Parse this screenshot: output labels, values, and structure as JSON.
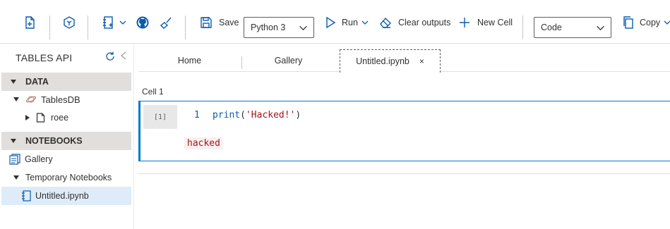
{
  "toolbar": {
    "save_label": "Save",
    "kernel": "Python 3",
    "run_label": "Run",
    "clear_label": "Clear outputs",
    "new_cell_label": "New Cell",
    "cell_type": "Code",
    "copy_label": "Copy"
  },
  "sidebar": {
    "title": "TABLES API",
    "data_section": "DATA",
    "database": "TablesDB",
    "table": "roee",
    "notebooks_section": "NOTEBOOKS",
    "gallery": "Gallery",
    "temporary": "Temporary Notebooks",
    "notebook_file": "Untitled.ipynb"
  },
  "tabs": [
    {
      "label": "Home"
    },
    {
      "label": "Gallery"
    },
    {
      "label": "Untitled.ipynb",
      "close": "×"
    }
  ],
  "notebook": {
    "cell_label": "Cell 1",
    "exec_count": "[1]",
    "line_number": "1",
    "code_fn": "print",
    "code_open": "(",
    "code_str": "'Hacked!'",
    "code_close": ")",
    "output": "hacked"
  },
  "colors": {
    "accent": "#0078d4",
    "icon": "#0b5cad",
    "selected_row": "#deecf9",
    "section_bg": "#e1dfdd",
    "string": "#a31515"
  }
}
